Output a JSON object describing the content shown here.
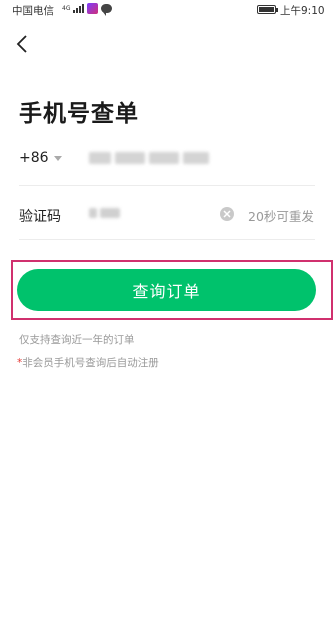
{
  "status_bar": {
    "carrier": "中国电信",
    "signal_text": "4G",
    "time": "上午9:10"
  },
  "header": {
    "back_icon": "chevron-left-icon"
  },
  "page": {
    "title": "手机号查单"
  },
  "form": {
    "country_code": "+86",
    "phone_placeholder": "",
    "code_label": "验证码",
    "resend_text": "20秒可重发"
  },
  "actions": {
    "query_button": "查询订单"
  },
  "notes": {
    "note1": "仅支持查询近一年的订单",
    "note2_mark": "*",
    "note2": "非会员手机号查询后自动注册"
  },
  "colors": {
    "accent": "#00c26c",
    "highlight_border": "#d0306e",
    "required_mark": "#e53935"
  }
}
